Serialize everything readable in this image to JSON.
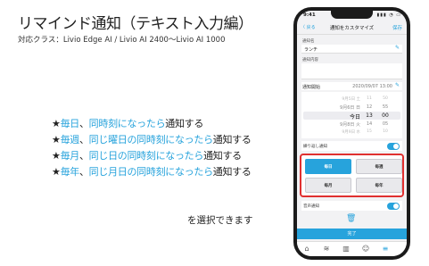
{
  "slide": {
    "title": "リマインド通知（テキスト入力編）",
    "subtitle": "対応クラス：Livio Edge AI / Livio AI 2400〜Livio AI 1000",
    "bullets": [
      {
        "star": "★",
        "blue1": "毎日",
        "sep": "、",
        "blue2": "同時刻になったら",
        "tail": "通知する"
      },
      {
        "star": "★",
        "blue1": "毎週",
        "sep": "、",
        "blue2": "同じ曜日の同時刻になったら",
        "tail": "通知する"
      },
      {
        "star": "★",
        "blue1": "毎月",
        "sep": "、",
        "blue2": "同じ日の同時刻になったら",
        "tail": "通知する"
      },
      {
        "star": "★",
        "blue1": "毎年",
        "sep": "、",
        "blue2": "同じ月日の同時刻になったら",
        "tail": "通知する"
      }
    ],
    "closing": "を選択できます"
  },
  "phone": {
    "status_time": "9:41",
    "status_icons": "▮▮▮ ◔ ▭",
    "nav": {
      "back": "〈 戻る",
      "title": "通知をカスタマイズ",
      "save": "保存"
    },
    "name_label": "通知名",
    "name_value": "ランチ",
    "content_label": "通知内容",
    "content_placeholder": "",
    "start_label": "通知開始",
    "start_value": "2020/09/07 13:00",
    "picker": {
      "rows": [
        {
          "date": "9月5日 土",
          "hour": "11",
          "min": "50"
        },
        {
          "date": "9月6日 日",
          "hour": "12",
          "min": "55"
        },
        {
          "date": "今日",
          "hour": "13",
          "min": "00"
        },
        {
          "date": "9月8日 火",
          "hour": "14",
          "min": "05"
        },
        {
          "date": "9月9日 水",
          "hour": "15",
          "min": "10"
        }
      ]
    },
    "repeat_label": "繰り返し通知",
    "frequency_options": [
      "毎日",
      "毎週",
      "毎月",
      "毎年"
    ],
    "frequency_selected": "毎日",
    "sound_label": "音声通知",
    "done": "完了",
    "icons": {
      "pencil": "pencil-icon",
      "trash": "trash-icon",
      "tabs": [
        "home-icon",
        "chart-icon",
        "bars-icon",
        "user-icon",
        "menu-icon"
      ]
    },
    "accent_color": "#27a3dc",
    "highlight_color": "#e03030"
  }
}
